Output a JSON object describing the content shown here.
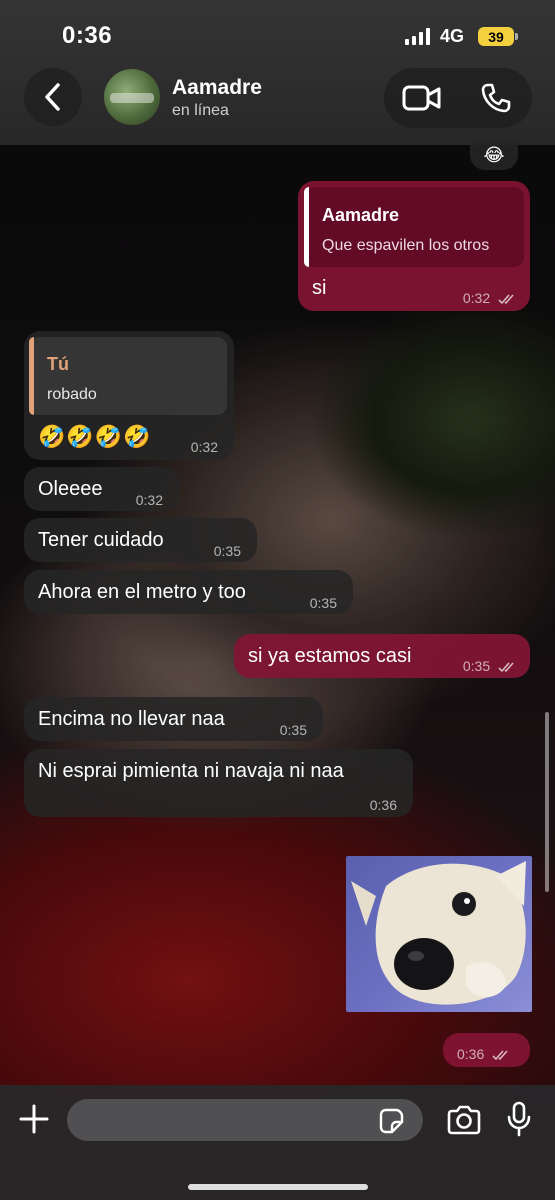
{
  "status_bar": {
    "time": "0:36",
    "network": "4G",
    "battery": "39"
  },
  "header": {
    "contact_name": "Aamadre",
    "contact_status": "en línea"
  },
  "messages": {
    "top_reaction": "😂",
    "m1": {
      "quote_name": "Aamadre",
      "quote_text": "Que espavilen los otros",
      "text": "si",
      "time": "0:32"
    },
    "m2": {
      "quote_name": "Tú",
      "quote_text": "robado",
      "text": "🤣🤣🤣🤣",
      "time": "0:32"
    },
    "m3": {
      "text": "Oleeee",
      "time": "0:32"
    },
    "m4": {
      "text": "Tener cuidado",
      "time": "0:35"
    },
    "m5": {
      "text": "Ahora en el metro y too",
      "time": "0:35"
    },
    "m6": {
      "text": "si ya estamos casi",
      "time": "0:35"
    },
    "m7": {
      "text": "Encima no llevar naa",
      "time": "0:35"
    },
    "m8": {
      "text": "Ni esprai pimienta ni navaja ni naa",
      "time": "0:36"
    },
    "m9": {
      "time": "0:36"
    }
  },
  "input_bar": {
    "placeholder": ""
  },
  "colors": {
    "outgoing_bubble": "#82143a",
    "incoming_bubble": "#262626",
    "quote_self_accent": "#e0a27a",
    "battery": "#f4d03f"
  },
  "icons": [
    "back-icon",
    "video-call-icon",
    "phone-icon",
    "read-ticks-icon",
    "plus-icon",
    "sticker-icon",
    "camera-icon",
    "microphone-icon"
  ]
}
